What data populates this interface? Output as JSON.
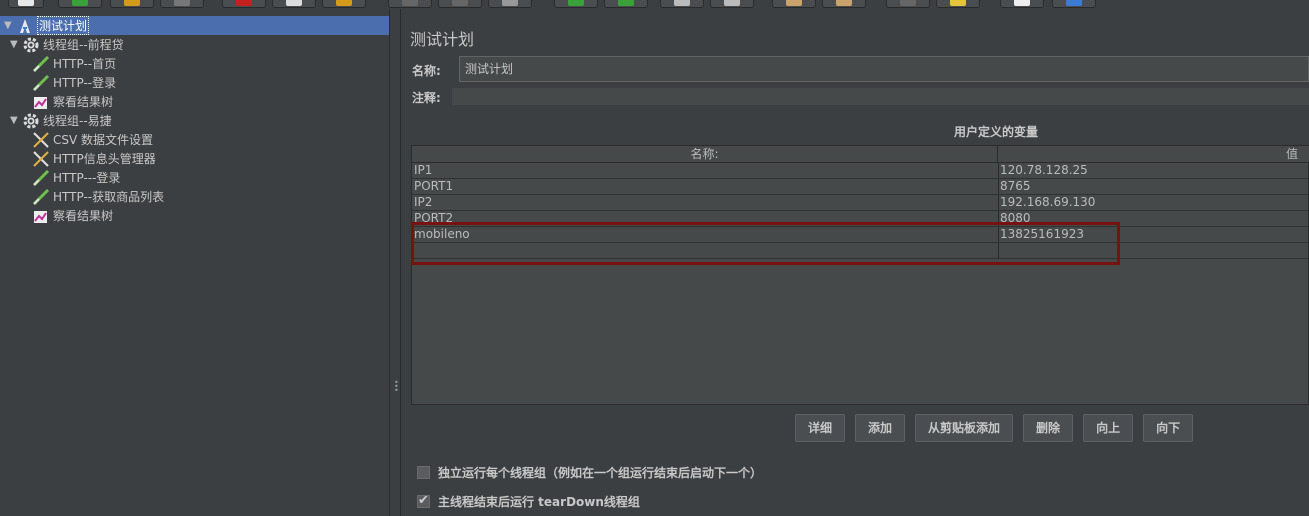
{
  "tree": {
    "root": {
      "label": "测试计划"
    },
    "groups": [
      {
        "label": "线程组--前程贷",
        "children": [
          {
            "label": "HTTP--首页",
            "icon": "sampler-icon"
          },
          {
            "label": "HTTP--登录",
            "icon": "sampler-icon"
          },
          {
            "label": "察看结果树",
            "icon": "listener-icon"
          }
        ]
      },
      {
        "label": "线程组--易捷",
        "children": [
          {
            "label": "CSV 数据文件设置",
            "icon": "config-icon"
          },
          {
            "label": "HTTP信息头管理器",
            "icon": "config-icon"
          },
          {
            "label": "HTTP---登录",
            "icon": "sampler-icon"
          },
          {
            "label": "HTTP--获取商品列表",
            "icon": "sampler-icon"
          },
          {
            "label": "察看结果树",
            "icon": "listener-icon"
          }
        ]
      }
    ]
  },
  "main": {
    "title": "测试计划",
    "name_label": "名称:",
    "name_value": "测试计划",
    "comment_label": "注释:",
    "variables_title": "用户定义的变量",
    "columns": {
      "name": "名称:",
      "value": "值"
    },
    "rows": [
      {
        "name": "IP1",
        "value": "120.78.128.25"
      },
      {
        "name": "PORT1",
        "value": "8765"
      },
      {
        "name": "IP2",
        "value": "192.168.69.130"
      },
      {
        "name": "PORT2",
        "value": "8080"
      },
      {
        "name": "mobileno",
        "value": "13825161923"
      }
    ],
    "buttons": {
      "detail": "详细",
      "add": "添加",
      "add_clipboard": "从剪贴板添加",
      "delete": "删除",
      "up": "向上",
      "down": "向下"
    },
    "checkboxes": [
      {
        "label": "独立运行每个线程组（例如在一个组运行结束后启动下一个）",
        "checked": false
      },
      {
        "label": "主线程结束后运行 tearDown线程组",
        "checked": true
      }
    ]
  },
  "colors": {
    "background": "#3c3f41",
    "selection": "#4b6eaf",
    "highlight_box": "#7a1111"
  }
}
